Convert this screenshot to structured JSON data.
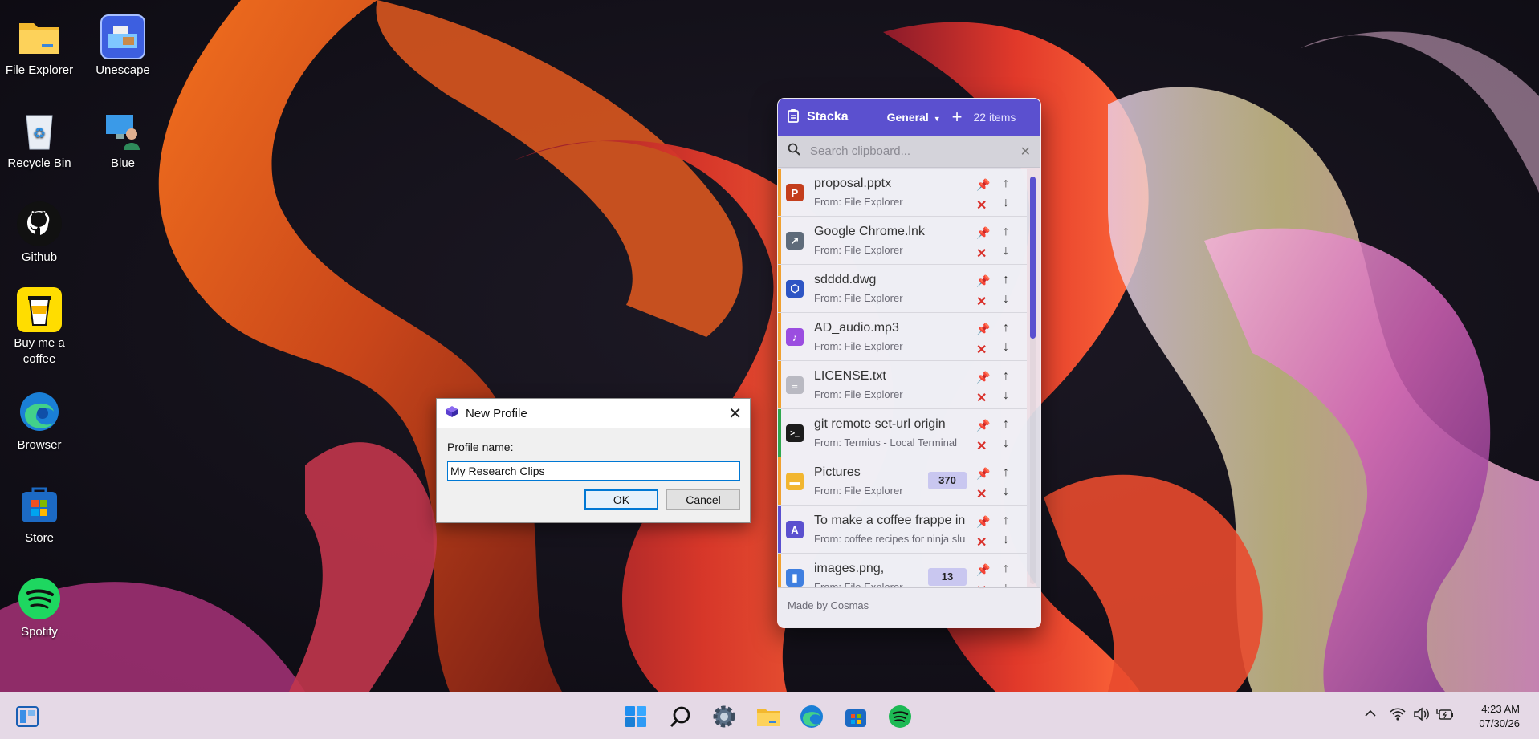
{
  "desktop": {
    "icons": [
      {
        "label": "File Explorer",
        "icon": "folder-icon"
      },
      {
        "label": "Unescape",
        "icon": "unescape-app-icon"
      },
      {
        "label": "Recycle Bin",
        "icon": "recycle-bin-icon"
      },
      {
        "label": "Blue",
        "icon": "user-pc-icon"
      },
      {
        "label": "Github",
        "icon": "github-icon"
      },
      {
        "label": "Buy me a coffee",
        "icon": "coffee-cup-icon"
      },
      {
        "label": "Browser",
        "icon": "edge-browser-icon"
      },
      {
        "label": "Store",
        "icon": "store-icon"
      },
      {
        "label": "Spotify",
        "icon": "spotify-icon"
      }
    ]
  },
  "stacka": {
    "title": "Stacka",
    "profile": "General",
    "add_symbol": "+",
    "item_count": "22 items",
    "search_placeholder": "Search clipboard...",
    "footer": "Made by Cosmas",
    "accent": "#5b50cf",
    "scroll_position": 0.0,
    "items": [
      {
        "title": "proposal.pptx",
        "source": "From: File Explorer",
        "badge": "",
        "icon_letter": "P",
        "icon_color": "#c43e1c",
        "stripe": "#f0a030"
      },
      {
        "title": "Google Chrome.lnk",
        "source": "From: File Explorer",
        "badge": "",
        "icon_letter": "↗",
        "icon_color": "#5f6b7a",
        "stripe": "#f0a030"
      },
      {
        "title": "sdddd.dwg",
        "source": "From: File Explorer",
        "badge": "",
        "icon_letter": "⬡",
        "icon_color": "#2e55c4",
        "stripe": "#f0a030"
      },
      {
        "title": "AD_audio.mp3",
        "source": "From: File Explorer",
        "badge": "",
        "icon_letter": "♪",
        "icon_color": "#9b4de0",
        "stripe": "#f0a030"
      },
      {
        "title": "LICENSE.txt",
        "source": "From: File Explorer",
        "badge": "",
        "icon_letter": "≡",
        "icon_color": "#b9b9c2",
        "stripe": "#f0a030"
      },
      {
        "title": "git remote set-url origin",
        "source": "From: Termius - Local Terminal",
        "badge": "",
        "icon_letter": ">_",
        "icon_color": "#1c1c1c",
        "stripe": "#2fa84f"
      },
      {
        "title": "Pictures",
        "source": "From: File Explorer",
        "badge": "370",
        "icon_letter": "▬",
        "icon_color": "#f2b630",
        "stripe": "#f0a030"
      },
      {
        "title": "To make a coffee frappe in",
        "source": "From: coffee recipes for ninja slu",
        "badge": "",
        "icon_letter": "A",
        "icon_color": "#5b50cf",
        "stripe": "#5b50cf"
      },
      {
        "title": "images.png,",
        "source": "From: File Explorer",
        "badge": "13",
        "icon_letter": "▮",
        "icon_color": "#3f7fe0",
        "stripe": "#f0a030"
      }
    ]
  },
  "dialog": {
    "title": "New Profile",
    "label": "Profile name:",
    "value": "My Research Clips",
    "ok": "OK",
    "cancel": "Cancel"
  },
  "taskbar": {
    "pinned": [
      "widgets-icon",
      "windows-start-icon",
      "search-icon",
      "settings-icon",
      "file-explorer-icon",
      "edge-icon",
      "store-icon",
      "spotify-icon"
    ],
    "tray": [
      "chevron-up-icon",
      "wifi-icon",
      "volume-icon",
      "battery-icon"
    ],
    "time": "4:23 AM",
    "date": "07/30/26"
  }
}
